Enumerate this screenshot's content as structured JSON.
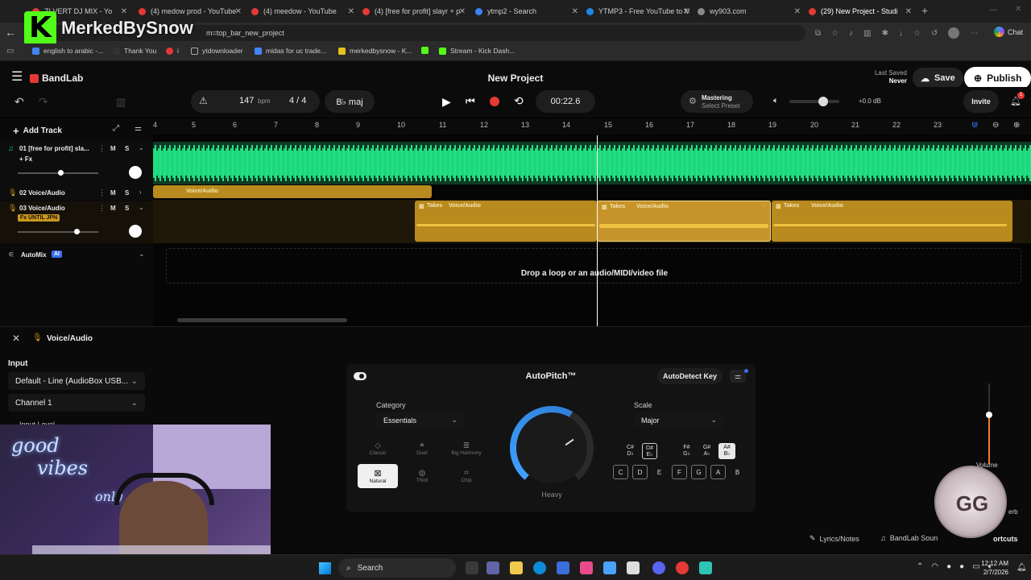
{
  "browser": {
    "tabs": [
      {
        "title": "ZI VERT DJ MIX - Yo",
        "color": "#e53935"
      },
      {
        "title": "(4) medow prod - YouTube",
        "color": "#e53935"
      },
      {
        "title": "(4) meedow - YouTube",
        "color": "#e53935"
      },
      {
        "title": "(4) [free for profit] slayr + p",
        "color": "#e53935"
      },
      {
        "title": "ytmp2 - Search",
        "color": "#3b82f6"
      },
      {
        "title": "YTMP3 - Free YouTube to M",
        "color": "#1e88e5"
      },
      {
        "title": "wy903.com",
        "color": "#888888"
      },
      {
        "title": "(29) New Project - Studi",
        "color": "#e53935"
      }
    ],
    "new_tab": "+",
    "overlay_logo_letter": "K",
    "overlay_name": "MerkedBySnow",
    "url": "m=top_bar_new_project",
    "chat_label": "Chat",
    "bookmarks": [
      {
        "label": "english to arabic -...",
        "color": "#4285f4"
      },
      {
        "label": "Thank You",
        "color": "#333333"
      },
      {
        "label": "i",
        "color": "#e53935"
      },
      {
        "label": "ytdownloader",
        "color": "#888888"
      },
      {
        "label": "midas for uc trade...",
        "color": "#4285f4"
      },
      {
        "label": "merkedbysnow - K...",
        "color": "#e8c21a"
      },
      {
        "label": "Stream - Kick Dash...",
        "color": "#53fc18"
      }
    ]
  },
  "app": {
    "brand": "BandLab",
    "project_title": "New Project",
    "last_saved_label": "Last Saved",
    "last_saved_value": "Never",
    "save_label": "Save",
    "publish_label": "Publish",
    "bpm_value": "147",
    "bpm_unit": "bpm",
    "time_signature": "4 / 4",
    "key": "B♭ maj",
    "time_display": "00:22.6",
    "mastering_label": "Mastering",
    "mastering_preset": "Select Preset",
    "volume_db": "+0.0 dB",
    "invite_label": "Invite",
    "notification_count": "1",
    "accent": "#1fd67c",
    "track_orange": "#b98a1e"
  },
  "timeline": {
    "add_track_label": "Add Track",
    "ruler_ticks": [
      "4",
      "5",
      "6",
      "7",
      "8",
      "9",
      "10",
      "11",
      "12",
      "13",
      "14",
      "15",
      "16",
      "17",
      "18",
      "19",
      "20",
      "21",
      "22",
      "23"
    ],
    "tracks": [
      {
        "name": "01 [free for profit] sla...",
        "fx": "+ Fx",
        "M": "M",
        "S": "S"
      },
      {
        "name": "02 Voice/Audio",
        "M": "M",
        "S": "S"
      },
      {
        "name": "03 Voice/Audio",
        "fx": "Fx UNTIL JPN",
        "M": "M",
        "S": "S"
      }
    ],
    "clip_label": "Voice/Audio",
    "takes_label": "Takes",
    "automix_label": "AutoMix",
    "ai_badge": "AI",
    "drop_text": "Drop a loop or an audio/MIDI/video file"
  },
  "panel": {
    "title": "Voice/Audio",
    "input_label": "Input",
    "input_device": "Default - Line (AudioBox USB...",
    "channel": "Channel 1",
    "input_level_label": "Input Level",
    "autopitch": {
      "title": "AutoPitch™",
      "autodetect_label": "AutoDetect Key",
      "category_label": "Category",
      "category_value": "Essentials",
      "categories": [
        "Classic",
        "Duet",
        "Big Harmony",
        "Natural",
        "Third",
        "Chip"
      ],
      "knob_label": "Heavy",
      "scale_label": "Scale",
      "scale_value": "Major",
      "sharps_top": [
        "C#",
        "D#",
        "F#",
        "G#",
        "A#"
      ],
      "sharps_bottom": [
        "D♭",
        "E♭",
        "G♭",
        "A♭",
        "B♭"
      ],
      "naturals": [
        "C",
        "D",
        "E",
        "F",
        "G",
        "A",
        "B"
      ]
    },
    "volume_label": "Volume",
    "reverb_label": "erb",
    "lyrics_label": "Lyrics/Notes",
    "sounds_label": "BandLab Soun",
    "shortcuts_label": "ortcuts"
  },
  "stream_overlay": {
    "neon_line1": "good",
    "neon_line2": "vibes",
    "neon_line3": "only",
    "badge_text": "GG"
  },
  "taskbar": {
    "search_label": "Search",
    "time": "12:12 AM",
    "date": "2/7/2026"
  }
}
